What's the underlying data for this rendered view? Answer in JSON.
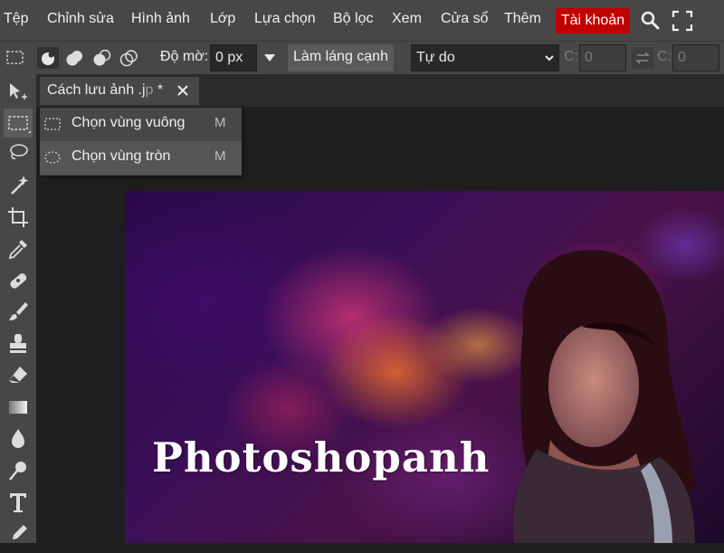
{
  "menu": {
    "items": [
      "Tệp",
      "Chỉnh sửa",
      "Hình ảnh",
      "Lớp",
      "Lựa chọn",
      "Bộ lọc",
      "Xem",
      "Cửa sổ",
      "Thêm"
    ],
    "account_label": "Tài khoản",
    "icons": [
      "search-icon",
      "fullscreen-icon"
    ]
  },
  "options": {
    "feather_label": "Độ mờ:",
    "feather_value": "0 px",
    "smooth_button": "Làm láng cạnh",
    "style_select": "Tự do",
    "width_label": "C:",
    "width_value": "0",
    "height_label": "C:",
    "height_value": "0"
  },
  "tools": [
    "move-tool",
    "marquee-tool",
    "lasso-tool",
    "magic-wand-tool",
    "crop-tool",
    "eyedropper-tool",
    "healing-tool",
    "brush-tool",
    "stamp-tool",
    "eraser-tool",
    "gradient-tool",
    "blur-tool",
    "dodge-tool",
    "type-tool",
    "pen-tool"
  ],
  "document_tab": {
    "title": "Cách lưu ảnh .j",
    "title_faded": "p",
    "modified": "*"
  },
  "flyout": {
    "items": [
      {
        "label": "Chọn vùng vuông",
        "key": "M"
      },
      {
        "label": "Chọn vùng tròn",
        "key": "M"
      }
    ]
  },
  "canvas": {
    "watermark": "Photoshopanh"
  },
  "colors": {
    "menubar": "#474747",
    "account": "#c20000",
    "workspace": "#1e1e1e"
  }
}
